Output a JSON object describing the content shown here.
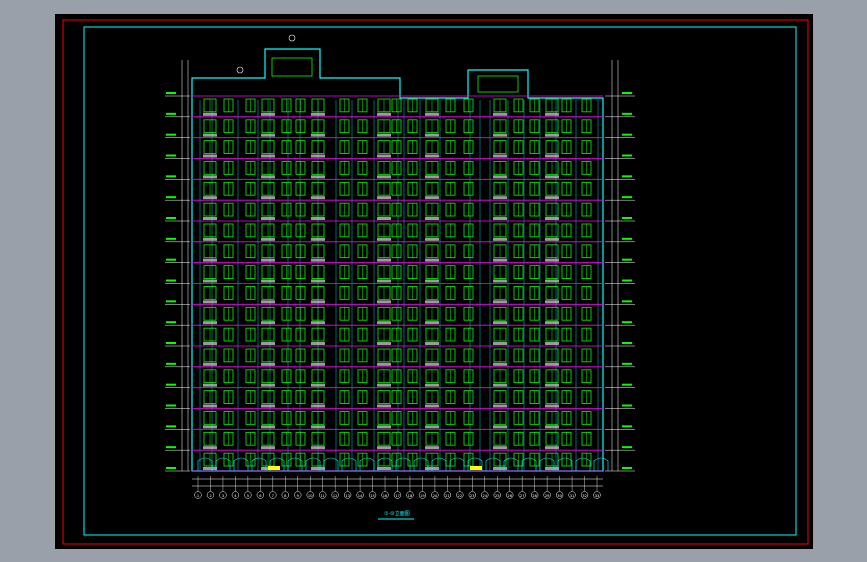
{
  "viewer": {
    "background_color": "#9aa0aa",
    "sheet_color": "#000000",
    "outer_frame_color": "#ff0000",
    "inner_frame_color": "#00ffff"
  },
  "drawing": {
    "caption": "①-⑩立面图",
    "floor_count": 18,
    "grid_axis_labels": [
      "1",
      "2",
      "3",
      "4",
      "5",
      "6",
      "7",
      "8",
      "9",
      "10",
      "11",
      "12",
      "13",
      "14",
      "15",
      "16",
      "17",
      "18",
      "19",
      "20",
      "21",
      "22",
      "23",
      "24",
      "25",
      "26",
      "27",
      "28",
      "29",
      "30",
      "31",
      "32",
      "33"
    ],
    "colors": {
      "structure": "#00ffff",
      "windows": "#00ff00",
      "floor_lines": "#ff00ff",
      "balcony_fill": "#c0c0c0",
      "dimensions": "#ffffff",
      "marker": "#ffff00"
    }
  }
}
